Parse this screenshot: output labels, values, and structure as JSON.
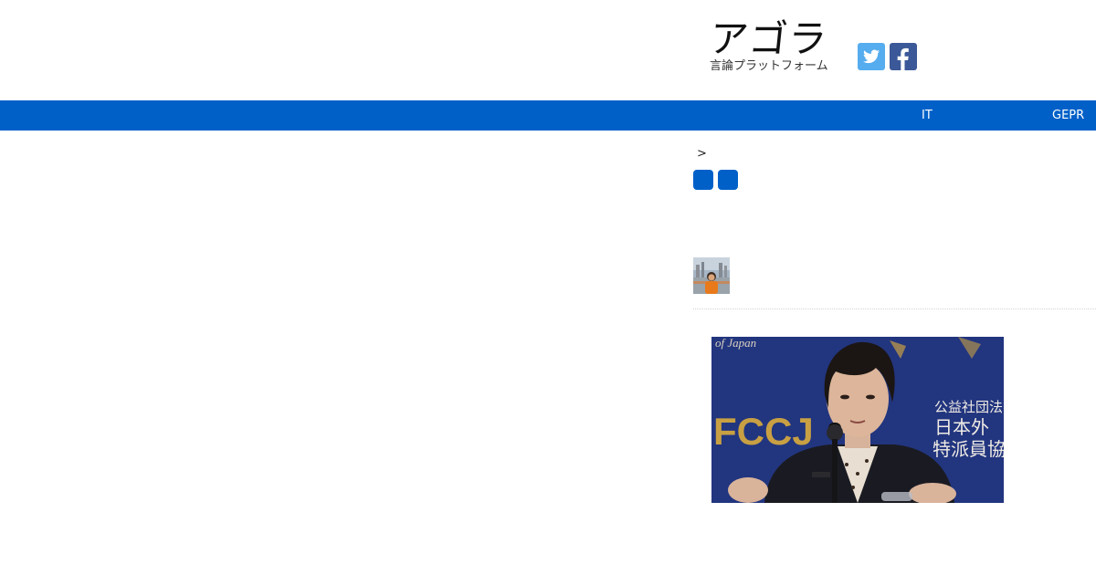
{
  "header": {
    "logo_text": "アゴラ",
    "logo_subtitle": "言論プラットフォーム",
    "social": [
      {
        "name": "twitter",
        "icon": "twitter-icon",
        "color": "#55acee"
      },
      {
        "name": "facebook",
        "icon": "facebook-icon",
        "color": "#3b5998"
      }
    ]
  },
  "nav": {
    "background": "#0060c8",
    "items": [
      "IT",
      "GEPR"
    ]
  },
  "breadcrumb": {
    "separator": ">"
  },
  "share": {
    "color": "#0060c8"
  },
  "article": {
    "image_overlay": {
      "corner_text": "of Japan",
      "banner_text": "FCCJ",
      "sign_lines": [
        "公益社団法",
        "日本外",
        "特派員協"
      ]
    }
  }
}
